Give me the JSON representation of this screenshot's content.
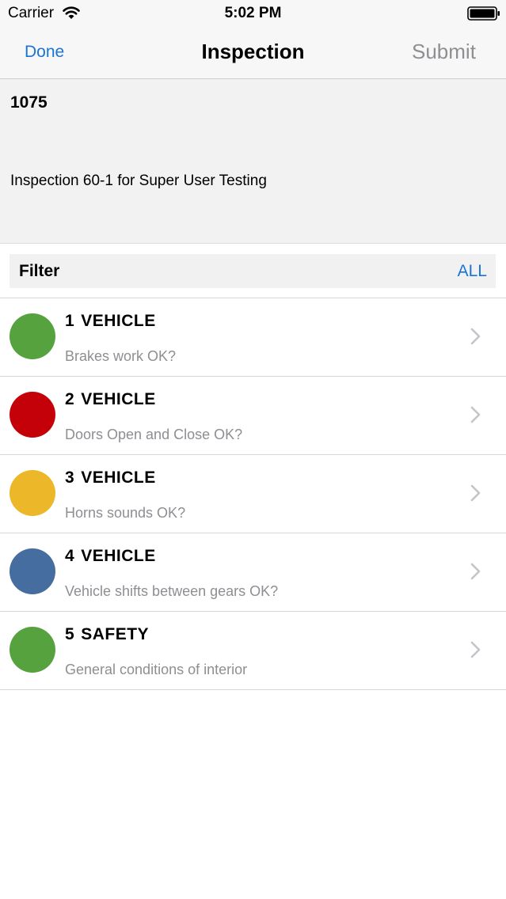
{
  "status": {
    "carrier": "Carrier",
    "time": "5:02 PM"
  },
  "nav": {
    "back": "Done",
    "title": "Inspection",
    "submit": "Submit"
  },
  "header": {
    "code": "1075",
    "description": "Inspection 60-1 for Super User Testing"
  },
  "filter": {
    "label": "Filter",
    "value": "ALL"
  },
  "items": [
    {
      "num": "1",
      "category": "VEHICLE",
      "question": "Brakes work OK?",
      "color": "#56a23f"
    },
    {
      "num": "2",
      "category": "VEHICLE",
      "question": "Doors Open and Close OK?",
      "color": "#c40008"
    },
    {
      "num": "3",
      "category": "VEHICLE",
      "question": "Horns sounds OK?",
      "color": "#ecb728"
    },
    {
      "num": "4",
      "category": "VEHICLE",
      "question": "Vehicle shifts between gears OK?",
      "color": "#466da0"
    },
    {
      "num": "5",
      "category": "SAFETY",
      "question": "General conditions of interior",
      "color": "#56a23f"
    }
  ],
  "icons": {
    "status": [
      "wifi-icon",
      "battery-icon"
    ],
    "row": "chevron-right-icon"
  }
}
